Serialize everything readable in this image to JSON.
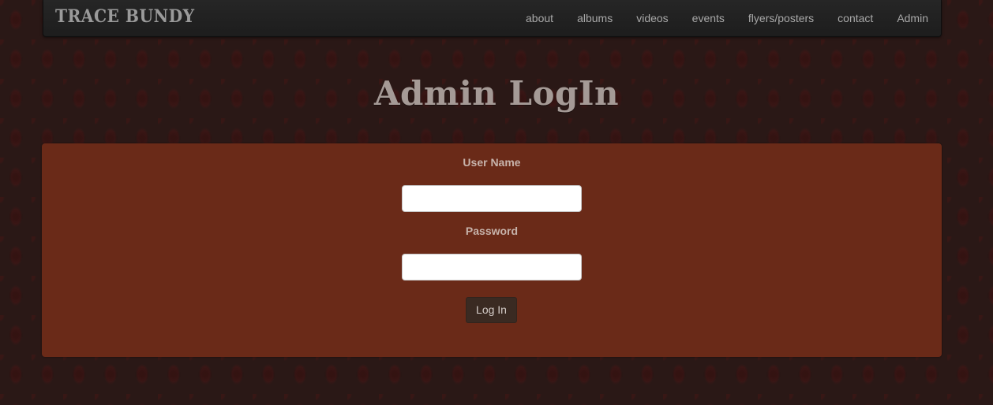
{
  "navbar": {
    "brand": "TRACE BUNDY",
    "links": [
      "about",
      "albums",
      "videos",
      "events",
      "flyers/posters",
      "contact",
      "Admin"
    ]
  },
  "page": {
    "title": "Admin LogIn"
  },
  "form": {
    "username_label": "User Name",
    "username_value": "",
    "password_label": "Password",
    "password_value": "",
    "submit_label": "Log In"
  },
  "colors": {
    "background": "#2a1816",
    "navbar": "#222222",
    "panel": "#6a2a18",
    "button": "#3a2a22",
    "title": "#a59a96"
  }
}
